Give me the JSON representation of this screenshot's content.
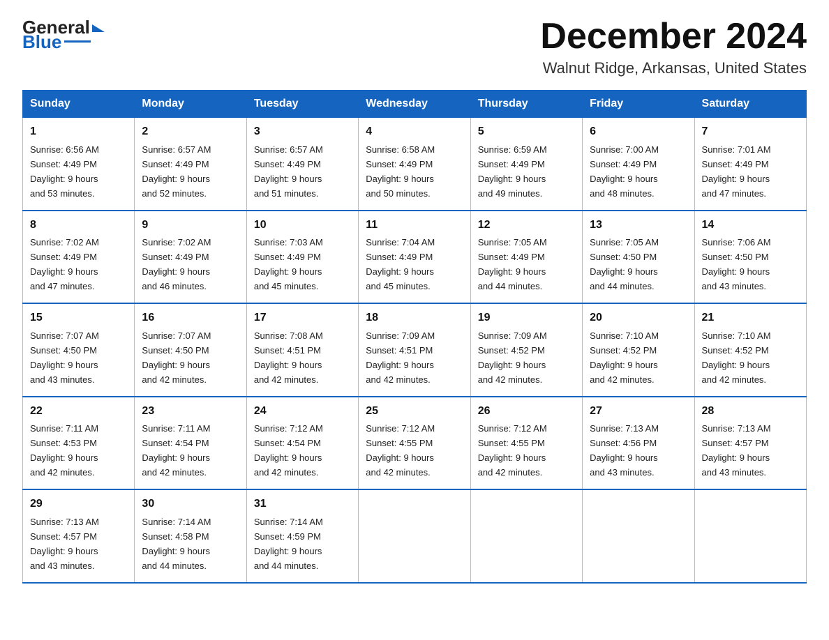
{
  "logo": {
    "general": "General",
    "blue": "Blue"
  },
  "title": "December 2024",
  "subtitle": "Walnut Ridge, Arkansas, United States",
  "weekdays": [
    "Sunday",
    "Monday",
    "Tuesday",
    "Wednesday",
    "Thursday",
    "Friday",
    "Saturday"
  ],
  "weeks": [
    [
      {
        "day": 1,
        "sunrise": "6:56 AM",
        "sunset": "4:49 PM",
        "daylight": "9 hours and 53 minutes."
      },
      {
        "day": 2,
        "sunrise": "6:57 AM",
        "sunset": "4:49 PM",
        "daylight": "9 hours and 52 minutes."
      },
      {
        "day": 3,
        "sunrise": "6:57 AM",
        "sunset": "4:49 PM",
        "daylight": "9 hours and 51 minutes."
      },
      {
        "day": 4,
        "sunrise": "6:58 AM",
        "sunset": "4:49 PM",
        "daylight": "9 hours and 50 minutes."
      },
      {
        "day": 5,
        "sunrise": "6:59 AM",
        "sunset": "4:49 PM",
        "daylight": "9 hours and 49 minutes."
      },
      {
        "day": 6,
        "sunrise": "7:00 AM",
        "sunset": "4:49 PM",
        "daylight": "9 hours and 48 minutes."
      },
      {
        "day": 7,
        "sunrise": "7:01 AM",
        "sunset": "4:49 PM",
        "daylight": "9 hours and 47 minutes."
      }
    ],
    [
      {
        "day": 8,
        "sunrise": "7:02 AM",
        "sunset": "4:49 PM",
        "daylight": "9 hours and 47 minutes."
      },
      {
        "day": 9,
        "sunrise": "7:02 AM",
        "sunset": "4:49 PM",
        "daylight": "9 hours and 46 minutes."
      },
      {
        "day": 10,
        "sunrise": "7:03 AM",
        "sunset": "4:49 PM",
        "daylight": "9 hours and 45 minutes."
      },
      {
        "day": 11,
        "sunrise": "7:04 AM",
        "sunset": "4:49 PM",
        "daylight": "9 hours and 45 minutes."
      },
      {
        "day": 12,
        "sunrise": "7:05 AM",
        "sunset": "4:49 PM",
        "daylight": "9 hours and 44 minutes."
      },
      {
        "day": 13,
        "sunrise": "7:05 AM",
        "sunset": "4:50 PM",
        "daylight": "9 hours and 44 minutes."
      },
      {
        "day": 14,
        "sunrise": "7:06 AM",
        "sunset": "4:50 PM",
        "daylight": "9 hours and 43 minutes."
      }
    ],
    [
      {
        "day": 15,
        "sunrise": "7:07 AM",
        "sunset": "4:50 PM",
        "daylight": "9 hours and 43 minutes."
      },
      {
        "day": 16,
        "sunrise": "7:07 AM",
        "sunset": "4:50 PM",
        "daylight": "9 hours and 42 minutes."
      },
      {
        "day": 17,
        "sunrise": "7:08 AM",
        "sunset": "4:51 PM",
        "daylight": "9 hours and 42 minutes."
      },
      {
        "day": 18,
        "sunrise": "7:09 AM",
        "sunset": "4:51 PM",
        "daylight": "9 hours and 42 minutes."
      },
      {
        "day": 19,
        "sunrise": "7:09 AM",
        "sunset": "4:52 PM",
        "daylight": "9 hours and 42 minutes."
      },
      {
        "day": 20,
        "sunrise": "7:10 AM",
        "sunset": "4:52 PM",
        "daylight": "9 hours and 42 minutes."
      },
      {
        "day": 21,
        "sunrise": "7:10 AM",
        "sunset": "4:52 PM",
        "daylight": "9 hours and 42 minutes."
      }
    ],
    [
      {
        "day": 22,
        "sunrise": "7:11 AM",
        "sunset": "4:53 PM",
        "daylight": "9 hours and 42 minutes."
      },
      {
        "day": 23,
        "sunrise": "7:11 AM",
        "sunset": "4:54 PM",
        "daylight": "9 hours and 42 minutes."
      },
      {
        "day": 24,
        "sunrise": "7:12 AM",
        "sunset": "4:54 PM",
        "daylight": "9 hours and 42 minutes."
      },
      {
        "day": 25,
        "sunrise": "7:12 AM",
        "sunset": "4:55 PM",
        "daylight": "9 hours and 42 minutes."
      },
      {
        "day": 26,
        "sunrise": "7:12 AM",
        "sunset": "4:55 PM",
        "daylight": "9 hours and 42 minutes."
      },
      {
        "day": 27,
        "sunrise": "7:13 AM",
        "sunset": "4:56 PM",
        "daylight": "9 hours and 43 minutes."
      },
      {
        "day": 28,
        "sunrise": "7:13 AM",
        "sunset": "4:57 PM",
        "daylight": "9 hours and 43 minutes."
      }
    ],
    [
      {
        "day": 29,
        "sunrise": "7:13 AM",
        "sunset": "4:57 PM",
        "daylight": "9 hours and 43 minutes."
      },
      {
        "day": 30,
        "sunrise": "7:14 AM",
        "sunset": "4:58 PM",
        "daylight": "9 hours and 44 minutes."
      },
      {
        "day": 31,
        "sunrise": "7:14 AM",
        "sunset": "4:59 PM",
        "daylight": "9 hours and 44 minutes."
      },
      null,
      null,
      null,
      null
    ]
  ]
}
